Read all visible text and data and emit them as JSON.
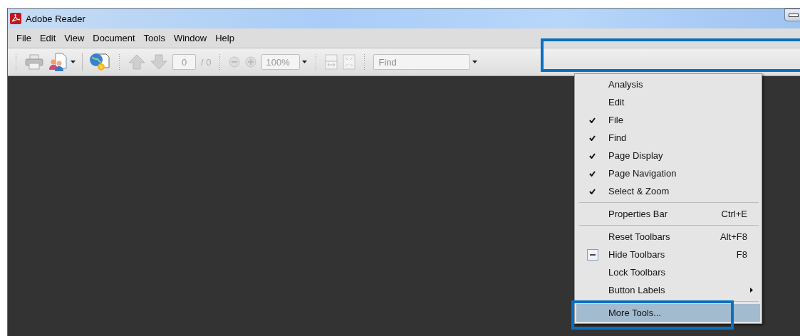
{
  "window": {
    "title": "Adobe Reader"
  },
  "menu_bar": [
    {
      "label": "File"
    },
    {
      "label": "Edit"
    },
    {
      "label": "View"
    },
    {
      "label": "Document"
    },
    {
      "label": "Tools"
    },
    {
      "label": "Window"
    },
    {
      "label": "Help"
    }
  ],
  "toolbar": {
    "page_field": {
      "value": "0"
    },
    "page_total": "/ 0",
    "zoom_field": {
      "value": "100%"
    },
    "find_field": {
      "placeholder": "Find"
    }
  },
  "context_menu": {
    "items": [
      {
        "kind": "item",
        "label": "Analysis",
        "checked": false,
        "selected": false,
        "submenu": false
      },
      {
        "kind": "item",
        "label": "Edit",
        "checked": false,
        "selected": false,
        "submenu": false
      },
      {
        "kind": "item",
        "label": "File",
        "checked": true,
        "selected": false,
        "submenu": false
      },
      {
        "kind": "item",
        "label": "Find",
        "checked": true,
        "selected": false,
        "submenu": false
      },
      {
        "kind": "item",
        "label": "Page Display",
        "checked": true,
        "selected": false,
        "submenu": false
      },
      {
        "kind": "item",
        "label": "Page Navigation",
        "checked": true,
        "selected": false,
        "submenu": false
      },
      {
        "kind": "item",
        "label": "Select & Zoom",
        "checked": true,
        "selected": false,
        "submenu": false
      },
      {
        "kind": "separator"
      },
      {
        "kind": "item",
        "label": "Properties Bar",
        "shortcut": "Ctrl+E",
        "checked": false,
        "selected": false,
        "submenu": false
      },
      {
        "kind": "separator"
      },
      {
        "kind": "item",
        "label": "Reset Toolbars",
        "shortcut": "Alt+F8",
        "checked": false,
        "selected": false,
        "submenu": false
      },
      {
        "kind": "boxed",
        "label": "Hide Toolbars",
        "shortcut": "F8",
        "checked": false,
        "selected": false,
        "submenu": false
      },
      {
        "kind": "item",
        "label": "Lock Toolbars",
        "checked": false,
        "selected": false,
        "submenu": false
      },
      {
        "kind": "item",
        "label": "Button Labels",
        "checked": false,
        "selected": false,
        "submenu": true
      },
      {
        "kind": "separator"
      },
      {
        "kind": "item",
        "label": "More Tools...",
        "checked": false,
        "selected": true,
        "submenu": false
      }
    ]
  }
}
